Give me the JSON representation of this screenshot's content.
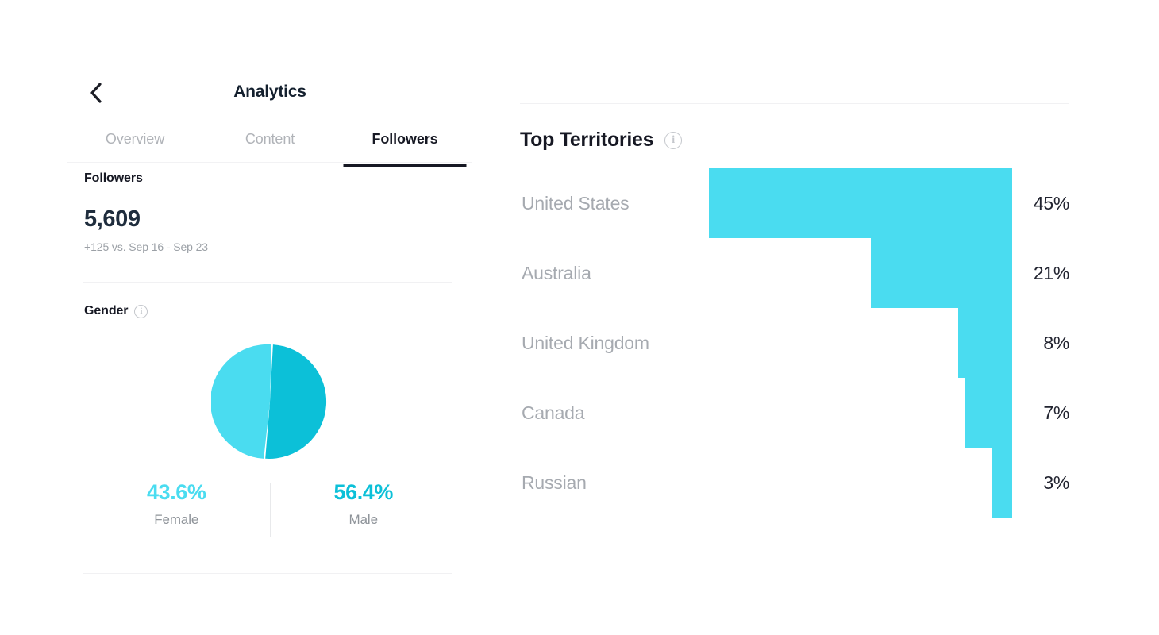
{
  "nav": {
    "back_icon": "chevron-left-icon",
    "title": "Analytics"
  },
  "tabs": [
    {
      "label": "Overview",
      "active": false
    },
    {
      "label": "Content",
      "active": false
    },
    {
      "label": "Followers",
      "active": true
    }
  ],
  "followers": {
    "section_label": "Followers",
    "count": "5,609",
    "delta": "+125 vs. Sep 16 - Sep 23"
  },
  "gender": {
    "label": "Gender",
    "info_icon": "info-circle-icon",
    "info_glyph": "i",
    "chart_data": {
      "type": "pie",
      "title": "Gender",
      "categories": [
        "Female",
        "Male"
      ],
      "values": [
        43.6,
        56.4
      ],
      "value_labels": [
        "43.6%",
        "56.4%"
      ],
      "colors": [
        "#4adcf0",
        "#0cc0d8"
      ],
      "legend": "below",
      "start_angle_deg": 3,
      "gap_deg": 2
    },
    "stats": [
      {
        "pct": "43.6%",
        "name": "Female",
        "color": "#4adcf0"
      },
      {
        "pct": "56.4%",
        "name": "Male",
        "color": "#0cc0d8"
      }
    ]
  },
  "top_territories": {
    "title": "Top Territories",
    "info_icon": "info-circle-icon",
    "info_glyph": "i",
    "chart_data": {
      "type": "bar",
      "orientation": "horizontal",
      "align": "right",
      "title": "Top Territories",
      "xlabel": "",
      "ylabel": "",
      "categories": [
        "United States",
        "Australia",
        "United Kingdom",
        "Canada",
        "Russian"
      ],
      "values": [
        45,
        21,
        8,
        7,
        3
      ],
      "value_labels": [
        "45%",
        "21%",
        "8%",
        "7%",
        "3%"
      ],
      "xlim": [
        0,
        45
      ],
      "grid": false,
      "bar_color": "#4adcf0"
    }
  },
  "theme": {
    "background": "#ffffff",
    "text_primary": "#161823",
    "text_muted": "#a6aab0",
    "accent_light": "#4adcf0",
    "accent_dark": "#0cc0d8",
    "divider": "#f1f1f3"
  }
}
